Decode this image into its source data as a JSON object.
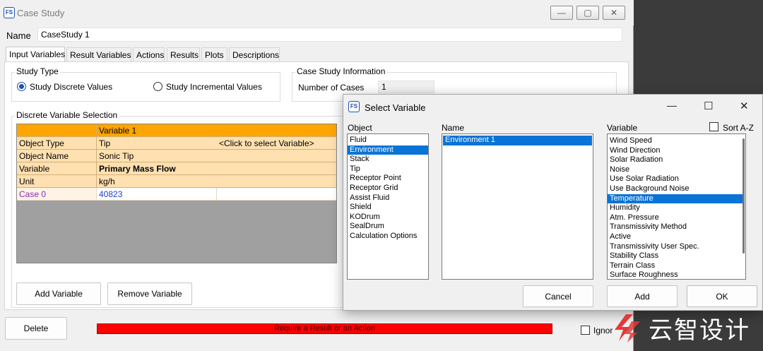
{
  "main": {
    "title": "Case Study",
    "icon_text": "FS",
    "window_controls": {
      "minimize": "—",
      "maximize": "▢",
      "close": "✕"
    },
    "name_label": "Name",
    "name_value": "CaseStudy 1",
    "tabs": [
      "Input Variables",
      "Result Variables",
      "Actions",
      "Results",
      "Plots",
      "Descriptions"
    ],
    "study_type": {
      "title": "Study Type",
      "option_discrete": "Study Discrete Values",
      "option_incremental": "Study Incremental Values"
    },
    "case_info": {
      "title": "Case Study Information",
      "num_cases_label": "Number of Cases",
      "num_cases_value": "1"
    },
    "dvs": {
      "title": "Discrete Variable Selection",
      "col_header": "Variable 1",
      "click_hint": "<Click to select Variable>",
      "rows": [
        {
          "label": "Object Type",
          "value": "Tip"
        },
        {
          "label": "Object Name",
          "value": "Sonic Tip"
        },
        {
          "label": "Variable",
          "value": "Primary Mass Flow"
        },
        {
          "label": "Unit",
          "value": "kg/h"
        }
      ],
      "case_label": "Case 0",
      "case_value": "40823"
    },
    "add_variable": "Add Variable",
    "remove_variable": "Remove Variable",
    "delete": "Delete",
    "status_message": "Require a Result or an Action",
    "ignore_label": "Ignor"
  },
  "dialog": {
    "title": "Select Variable",
    "icon_text": "FS",
    "window_controls": {
      "minimize": "—",
      "maximize": "☐",
      "close": "✕"
    },
    "object_label": "Object",
    "name_label": "Name",
    "variable_label": "Variable",
    "sort_label": "Sort A-Z",
    "objects": [
      "Fluid",
      "Environment",
      "Stack",
      "Tip",
      "Receptor Point",
      "Receptor Grid",
      "Assist Fluid",
      "Shield",
      "KODrum",
      "SealDrum",
      "Calculation Options"
    ],
    "names": [
      "Environment 1"
    ],
    "variables": [
      "Wind Speed",
      "Wind Direction",
      "Solar Radiation",
      "Noise",
      "Use Solar Radiation",
      "Use Background Noise",
      "Temperature",
      "Humidity",
      "Atm. Pressure",
      "Transmissivity Method",
      "Active",
      "Transmissivity User Spec.",
      "Stability Class",
      "Terrain Class",
      "Surface Roughness"
    ],
    "cancel": "Cancel",
    "add": "Add",
    "ok": "OK"
  },
  "watermark": {
    "text": "云智设计"
  },
  "colors": {
    "grid_header": "#ffa500",
    "grid_rows": "#ffe0b0",
    "selection": "#0a74d6",
    "status_bar": "#ff0000",
    "watermark": "#e23a3a"
  }
}
